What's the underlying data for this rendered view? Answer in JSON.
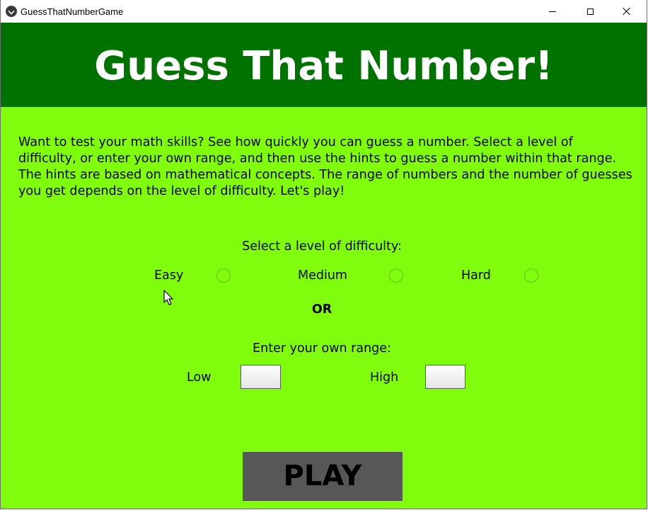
{
  "window": {
    "title": "GuessThatNumberGame"
  },
  "header": {
    "title": "Guess That Number!"
  },
  "intro": {
    "text": "Want to test your math skills?  See how quickly you can guess a number.  Select a level of difficulty, or enter your own range, and then use the hints to guess a number within that range.  The hints are based on mathematical concepts.  The range of numbers and the number of guesses you get depends on the level of difficulty.  Let's play!"
  },
  "difficulty": {
    "prompt": "Select a level of difficulty:",
    "options": [
      {
        "label": "Easy",
        "selected": false
      },
      {
        "label": "Medium",
        "selected": false
      },
      {
        "label": "Hard",
        "selected": false
      }
    ]
  },
  "or_label": "OR",
  "range": {
    "prompt": "Enter your own range:",
    "low_label": "Low",
    "low_value": "",
    "high_label": "High",
    "high_value": ""
  },
  "play_button": {
    "label": "PLAY"
  },
  "colors": {
    "header_bg": "#007200",
    "body_bg": "#80fd0c",
    "button_bg": "#575757",
    "radio_ring": "#66c00a"
  },
  "icons": {
    "app": "app-logo-icon",
    "minimize": "minimize-icon",
    "maximize": "maximize-icon",
    "close": "close-icon",
    "cursor": "mouse-pointer-icon"
  }
}
